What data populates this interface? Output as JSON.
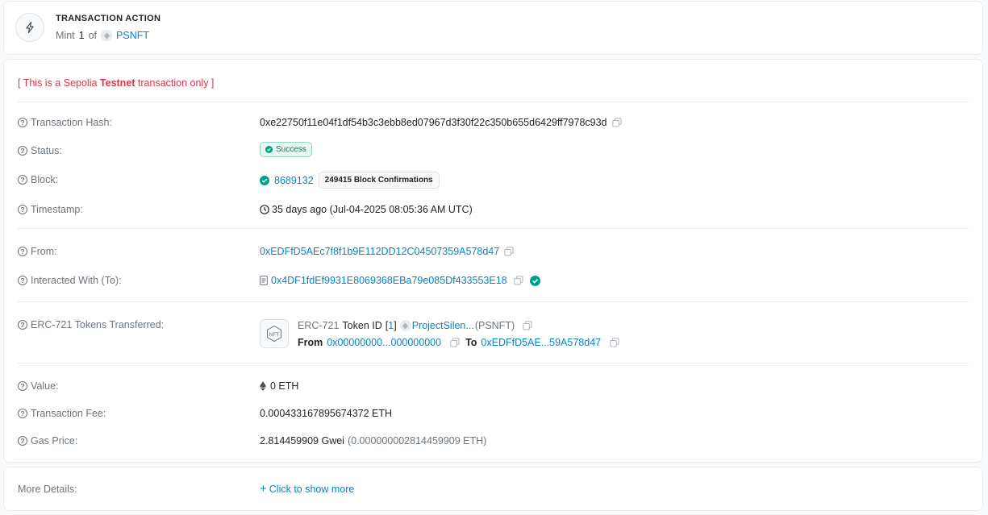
{
  "action": {
    "title": "TRANSACTION ACTION",
    "verb": "Mint",
    "count": "1",
    "of": "of",
    "token": "PSNFT",
    "icon": "lightning-icon"
  },
  "testnet": {
    "open": "[ This is a Sepolia ",
    "bold": "Testnet",
    "close": " transaction only ]"
  },
  "fields": {
    "tx_hash": {
      "label": "Transaction Hash:",
      "value": "0xe22750f11e04f1df54b3c3ebb8ed07967d3f30f22c350b655d6429ff7978c93d"
    },
    "status": {
      "label": "Status:",
      "value": "Success"
    },
    "block": {
      "label": "Block:",
      "value": "8689132",
      "confirmations": "249415 Block Confirmations"
    },
    "timestamp": {
      "label": "Timestamp:",
      "value": "35 days ago (Jul-04-2025 08:05:36 AM UTC)"
    },
    "from": {
      "label": "From:",
      "value": "0xEDFfD5AEc7f8f1b9E112DD12C04507359A578d47"
    },
    "to": {
      "label": "Interacted With (To):",
      "value": "0x4DF1fdEf9931E8069368EBa79e085Df433553E18"
    },
    "erc721": {
      "label": "ERC-721 Tokens Transferred:",
      "standard": "ERC-721",
      "token_id_label": "Token ID",
      "token_id_open": "[",
      "token_id": "1",
      "token_id_close": "]",
      "token_name": "ProjectSilen...",
      "token_symbol": "(PSNFT)",
      "from_label": "From",
      "from_value": "0x00000000...000000000",
      "to_label": "To",
      "to_value": "0xEDFfD5AE...59A578d47",
      "nft_icon_text": "NFT"
    },
    "value": {
      "label": "Value:",
      "value": "0 ETH"
    },
    "fee": {
      "label": "Transaction Fee:",
      "value": "0.000433167895674372 ETH"
    },
    "gas": {
      "label": "Gas Price:",
      "value": "2.814459909 Gwei",
      "eth": "(0.000000002814459909 ETH)"
    }
  },
  "more": {
    "label": "More Details:",
    "link": "Click to show more",
    "plus": "+"
  },
  "colors": {
    "link": "#0784c3",
    "success": "#00a186",
    "testnet": "#dc3545",
    "muted": "#6c757d"
  }
}
